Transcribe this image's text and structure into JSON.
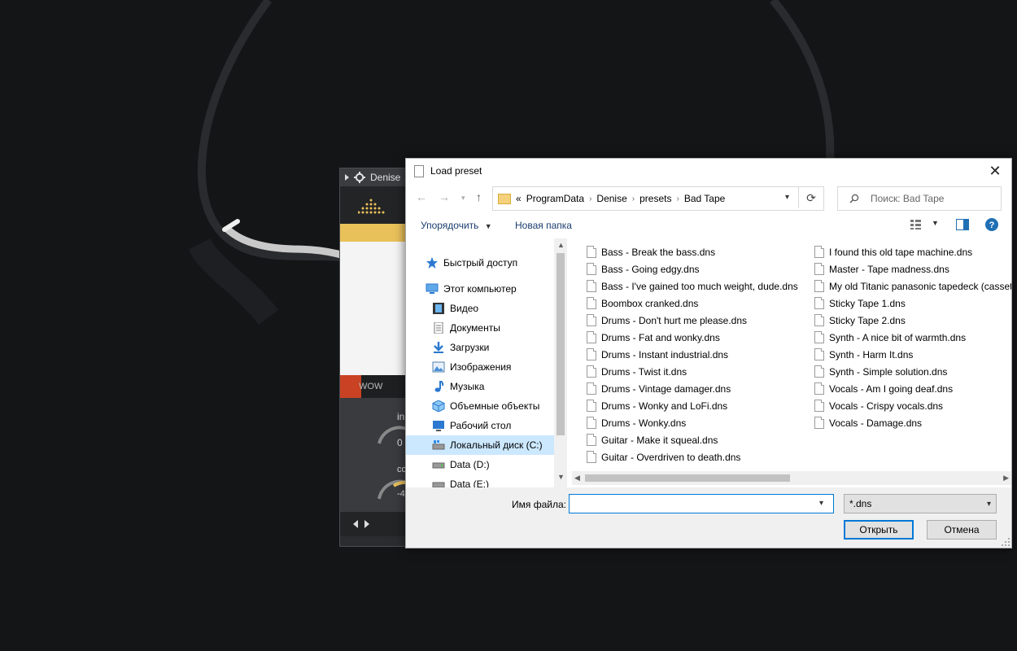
{
  "plugin": {
    "title": "Denise",
    "wow_label": "WOW",
    "knob1_label": "in",
    "knob1_value": "0",
    "knob2_label": "co",
    "knob2_value": "-4"
  },
  "dialog": {
    "title": "Load preset",
    "close_glyph": "✕",
    "path": [
      "ProgramData",
      "Denise",
      "presets",
      "Bad Tape"
    ],
    "path_overflow": "«",
    "search_placeholder": "Поиск: Bad Tape",
    "organize_label": "Упорядочить",
    "new_folder_label": "Новая папка",
    "help_glyph": "?",
    "nav_items": [
      {
        "label": "Быстрый доступ",
        "icon": "star-icon"
      },
      {
        "label": "Этот компьютер",
        "icon": "monitor-icon"
      },
      {
        "label": "Видео",
        "icon": "video-icon"
      },
      {
        "label": "Документы",
        "icon": "documents-icon"
      },
      {
        "label": "Загрузки",
        "icon": "download-icon"
      },
      {
        "label": "Изображения",
        "icon": "pictures-icon"
      },
      {
        "label": "Музыка",
        "icon": "music-icon"
      },
      {
        "label": "Объемные объекты",
        "icon": "cube-icon"
      },
      {
        "label": "Рабочий стол",
        "icon": "desktop-icon"
      },
      {
        "label": "Локальный диск (C:)",
        "icon": "drive-icon"
      },
      {
        "label": "Data (D:)",
        "icon": "drive-icon"
      },
      {
        "label": "Data (E:)",
        "icon": "drive-icon"
      }
    ],
    "files_col1": [
      "Bass - Break the bass.dns",
      "Bass - Going edgy.dns",
      "Bass - I've gained too much weight, dude.dns",
      "Boombox cranked.dns",
      "Drums - Don't hurt me please.dns",
      "Drums - Fat and wonky.dns",
      "Drums - Instant industrial.dns",
      "Drums - Twist it.dns",
      "Drums - Vintage damager.dns",
      "Drums - Wonky and LoFi.dns",
      "Drums - Wonky.dns",
      "Guitar - Make it squeal.dns",
      "Guitar - Overdriven to death.dns"
    ],
    "files_col2": [
      "I found this old tape machine.dns",
      "Master - Tape madness.dns",
      "My old Titanic panasonic tapedeck (cassette).dns",
      "Sticky Tape 1.dns",
      "Sticky Tape 2.dns",
      "Synth - A nice bit of warmth.dns",
      "Synth - Harm It.dns",
      "Synth - Simple solution.dns",
      "Vocals - Am I going deaf.dns",
      "Vocals - Crispy vocals.dns",
      "Vocals - Damage.dns"
    ],
    "filename_label": "Имя файла:",
    "filename_value": "",
    "filter_value": "*.dns",
    "open_label": "Открыть",
    "cancel_label": "Отмена"
  },
  "colors": {
    "accent": "#0078d7",
    "selection": "#cce8ff",
    "plugin_yellow": "#e9c15a",
    "plugin_red": "#c94224"
  }
}
